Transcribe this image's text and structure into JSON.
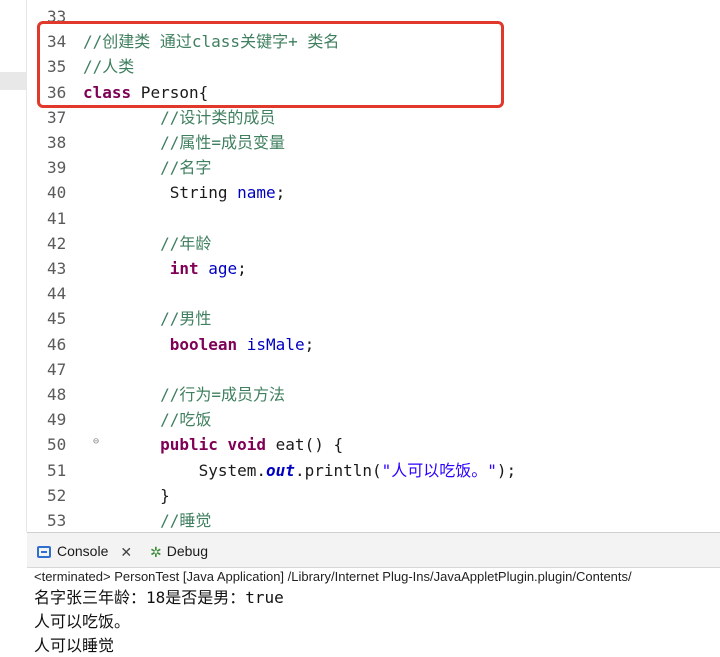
{
  "editor": {
    "lines": [
      {
        "num": "33",
        "segs": []
      },
      {
        "num": "34",
        "segs": [
          {
            "t": "//创建类 通过class关键字+ 类名",
            "c": "comment"
          }
        ]
      },
      {
        "num": "35",
        "segs": [
          {
            "t": "//人类",
            "c": "comment"
          }
        ]
      },
      {
        "num": "36",
        "segs": [
          {
            "t": "class",
            "c": "kw"
          },
          {
            "t": " Person{",
            "c": "plain"
          }
        ]
      },
      {
        "num": "37",
        "segs": [
          {
            "t": "        ",
            "c": "plain"
          },
          {
            "t": "//设计类的成员",
            "c": "comment"
          }
        ]
      },
      {
        "num": "38",
        "segs": [
          {
            "t": "        ",
            "c": "plain"
          },
          {
            "t": "//属性=成员变量",
            "c": "comment"
          }
        ]
      },
      {
        "num": "39",
        "segs": [
          {
            "t": "        ",
            "c": "plain"
          },
          {
            "t": "//名字",
            "c": "comment"
          }
        ]
      },
      {
        "num": "40",
        "segs": [
          {
            "t": "         String ",
            "c": "plain"
          },
          {
            "t": "name",
            "c": "field"
          },
          {
            "t": ";",
            "c": "plain"
          }
        ]
      },
      {
        "num": "41",
        "segs": []
      },
      {
        "num": "42",
        "segs": [
          {
            "t": "        ",
            "c": "plain"
          },
          {
            "t": "//年龄",
            "c": "comment"
          }
        ]
      },
      {
        "num": "43",
        "segs": [
          {
            "t": "         ",
            "c": "plain"
          },
          {
            "t": "int",
            "c": "kw"
          },
          {
            "t": " ",
            "c": "plain"
          },
          {
            "t": "age",
            "c": "field"
          },
          {
            "t": ";",
            "c": "plain"
          }
        ]
      },
      {
        "num": "44",
        "segs": []
      },
      {
        "num": "45",
        "segs": [
          {
            "t": "        ",
            "c": "plain"
          },
          {
            "t": "//男性",
            "c": "comment"
          }
        ]
      },
      {
        "num": "46",
        "segs": [
          {
            "t": "         ",
            "c": "plain"
          },
          {
            "t": "boolean",
            "c": "kw"
          },
          {
            "t": " ",
            "c": "plain"
          },
          {
            "t": "isMale",
            "c": "field"
          },
          {
            "t": ";",
            "c": "plain"
          }
        ]
      },
      {
        "num": "47",
        "segs": []
      },
      {
        "num": "48",
        "segs": [
          {
            "t": "        ",
            "c": "plain"
          },
          {
            "t": "//行为=成员方法",
            "c": "comment"
          }
        ]
      },
      {
        "num": "49",
        "segs": [
          {
            "t": "        ",
            "c": "plain"
          },
          {
            "t": "//吃饭",
            "c": "comment"
          }
        ]
      },
      {
        "num": "50",
        "fold": true,
        "segs": [
          {
            "t": "        ",
            "c": "plain"
          },
          {
            "t": "public",
            "c": "kw"
          },
          {
            "t": " ",
            "c": "plain"
          },
          {
            "t": "void",
            "c": "kw"
          },
          {
            "t": " eat() {",
            "c": "plain"
          }
        ]
      },
      {
        "num": "51",
        "segs": [
          {
            "t": "            System.",
            "c": "plain"
          },
          {
            "t": "out",
            "c": "static-field"
          },
          {
            "t": ".println(",
            "c": "plain"
          },
          {
            "t": "\"人可以吃饭。\"",
            "c": "str"
          },
          {
            "t": ");",
            "c": "plain"
          }
        ]
      },
      {
        "num": "52",
        "segs": [
          {
            "t": "        }",
            "c": "plain"
          }
        ]
      },
      {
        "num": "53",
        "segs": [
          {
            "t": "        ",
            "c": "plain"
          },
          {
            "t": "//睡觉",
            "c": "comment"
          }
        ]
      }
    ]
  },
  "console": {
    "tab_console": "Console",
    "tab_close": "✕",
    "tab_debug": "Debug",
    "terminated": "<terminated> PersonTest [Java Application] /Library/Internet Plug-Ins/JavaAppletPlugin.plugin/Contents/",
    "output": [
      "名字张三年龄：18是否是男：true",
      "人可以吃饭。",
      "人可以睡觉"
    ]
  },
  "icons": {
    "console_tab_icon": "console-icon",
    "debug_tab_icon": "bug-icon",
    "fold_icon": "collapse-minus-icon"
  },
  "colors": {
    "highlight": "#e0392b",
    "keyword": "#7f0055",
    "comment": "#3f7f5f",
    "field": "#0000c0",
    "string": "#2a00ff"
  }
}
